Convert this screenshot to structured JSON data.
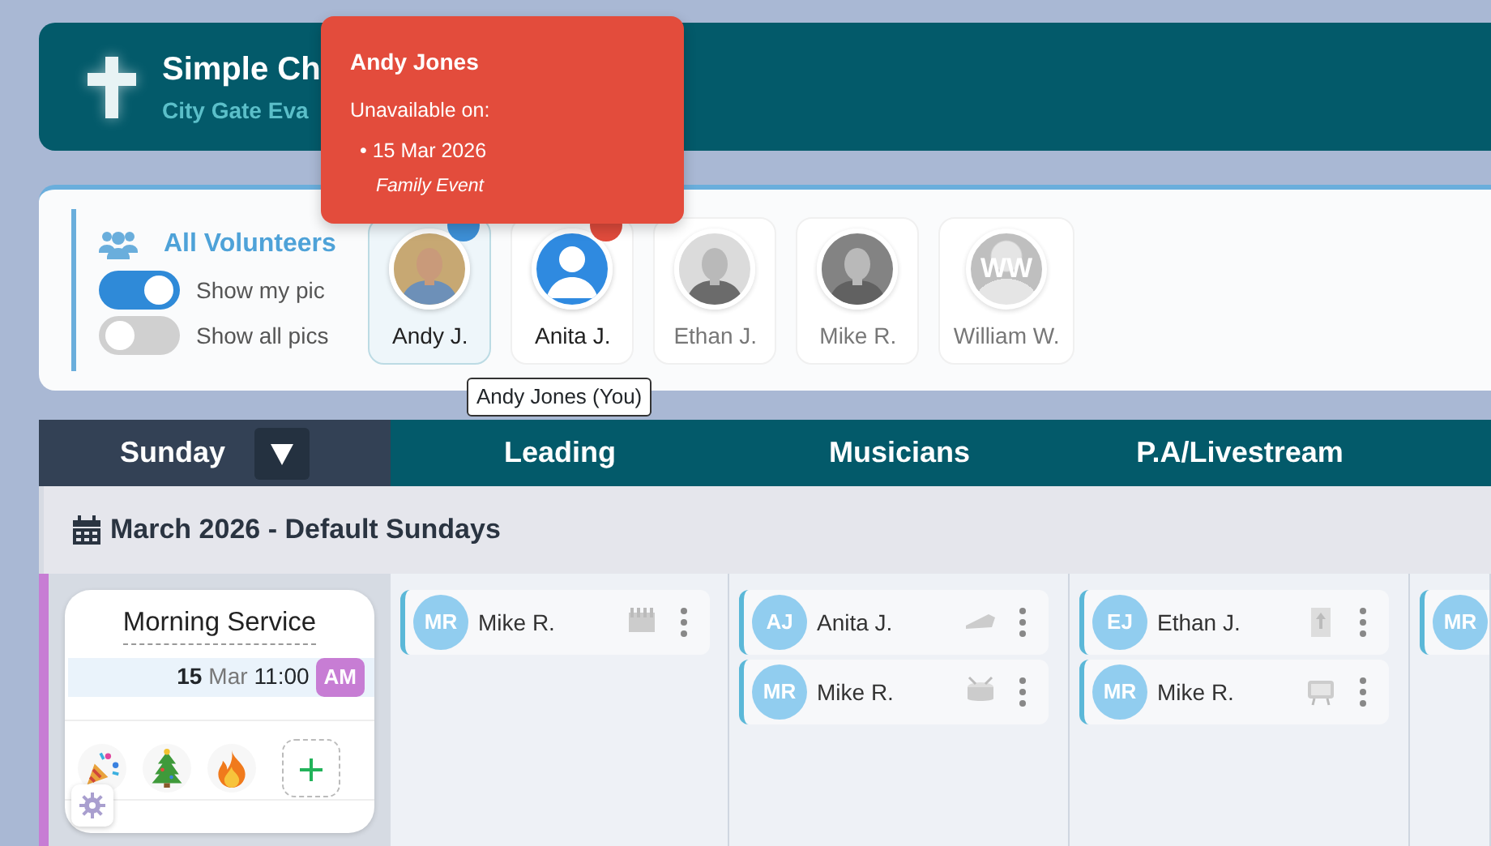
{
  "header": {
    "title": "Simple Ch",
    "subtitle": "City Gate Eva"
  },
  "popup": {
    "name": "Andy Jones",
    "label": "Unavailable on:",
    "dates": [
      {
        "date": "• 15 Mar 2026",
        "reason": "Family Event"
      }
    ]
  },
  "volunteer_panel": {
    "title": "All Volunteers",
    "toggles": [
      {
        "label": "Show my pic",
        "on": true
      },
      {
        "label": "Show all pics",
        "on": false
      }
    ],
    "volunteers": [
      {
        "name": "Andy J.",
        "selected": true,
        "dimmed": false,
        "color": "#3d8fd6"
      },
      {
        "name": "Anita J.",
        "kind": "default",
        "selected": false,
        "dimmed": false,
        "color": "#e04b3c"
      },
      {
        "name": "Ethan J.",
        "selected": false,
        "dimmed": true
      },
      {
        "name": "Mike R.",
        "selected": false,
        "dimmed": true
      },
      {
        "name": "William W.",
        "kind": "initials",
        "initials": "WW",
        "selected": false,
        "dimmed": true
      }
    ],
    "tooltip": "Andy Jones (You)"
  },
  "rota": {
    "day": "Sunday",
    "columns": [
      "Leading",
      "Musicians",
      "P.A/Livestream"
    ],
    "month": "March 2026 - Default Sundays",
    "service": {
      "name": "Morning Service",
      "day": "15",
      "month": "Mar",
      "time": "11:00",
      "period": "AM"
    },
    "cells": [
      [
        {
          "initials": "MR",
          "name": "Mike R."
        }
      ],
      [
        {
          "initials": "AJ",
          "name": "Anita J."
        },
        {
          "initials": "MR",
          "name": "Mike R."
        }
      ],
      [
        {
          "initials": "EJ",
          "name": "Ethan J."
        },
        {
          "initials": "MR",
          "name": "Mike R."
        }
      ],
      [
        {
          "initials": "MR"
        }
      ]
    ]
  }
}
